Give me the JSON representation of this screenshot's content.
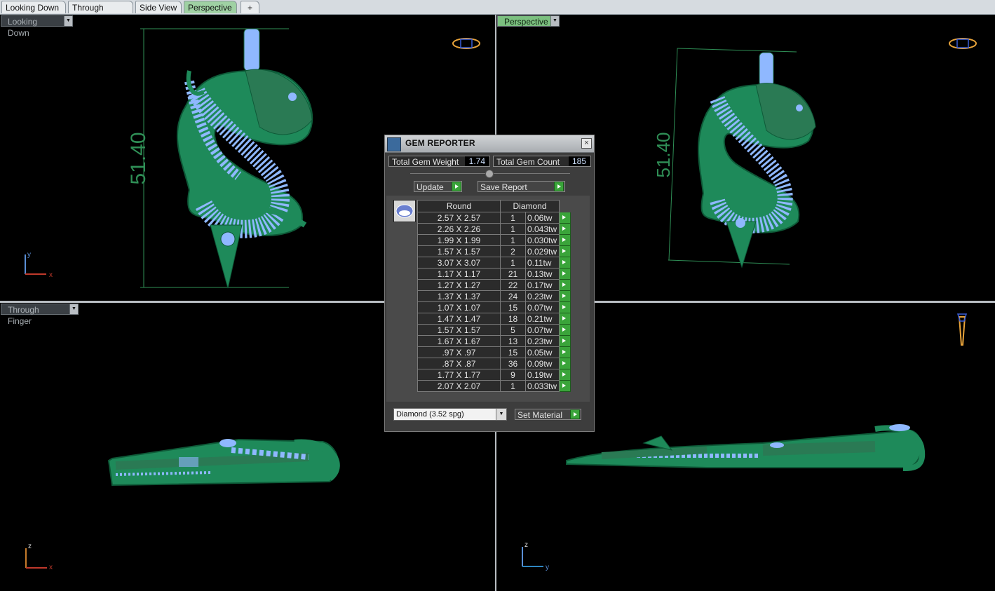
{
  "tabs": [
    {
      "label": "Looking Down",
      "active": false
    },
    {
      "label": "Through Finger",
      "active": false
    },
    {
      "label": "Side View",
      "active": false
    },
    {
      "label": "Perspective",
      "active": true
    }
  ],
  "add_tab_symbol": "+",
  "viewports": {
    "top_left": {
      "label": "Looking Down",
      "dimension": "51.40",
      "axes": [
        "y",
        "x"
      ]
    },
    "top_right": {
      "label": "Perspective",
      "dimension": "51.40"
    },
    "bottom_left": {
      "label": "Through Finger",
      "axes": [
        "z",
        "x"
      ]
    },
    "bottom_right": {
      "axes": [
        "z",
        "y"
      ]
    }
  },
  "gem_reporter": {
    "title": "GEM REPORTER",
    "close_symbol": "×",
    "total_weight_label": "Total Gem Weight",
    "total_weight_value": "1.74",
    "total_count_label": "Total Gem Count",
    "total_count_value": "185",
    "update_label": "Update",
    "save_report_label": "Save Report",
    "shape_header": "Round",
    "material_header": "Diamond",
    "rows": [
      {
        "size": "2.57 X 2.57",
        "count": "1",
        "weight": "0.06tw"
      },
      {
        "size": "2.26 X 2.26",
        "count": "1",
        "weight": "0.043tw"
      },
      {
        "size": "1.99 X 1.99",
        "count": "1",
        "weight": "0.030tw"
      },
      {
        "size": "1.57 X 1.57",
        "count": "2",
        "weight": "0.029tw"
      },
      {
        "size": "3.07 X 3.07",
        "count": "1",
        "weight": "0.11tw"
      },
      {
        "size": "1.17 X 1.17",
        "count": "21",
        "weight": "0.13tw"
      },
      {
        "size": "1.27 X 1.27",
        "count": "22",
        "weight": "0.17tw"
      },
      {
        "size": "1.37 X 1.37",
        "count": "24",
        "weight": "0.23tw"
      },
      {
        "size": "1.07 X 1.07",
        "count": "15",
        "weight": "0.07tw"
      },
      {
        "size": "1.47 X 1.47",
        "count": "18",
        "weight": "0.21tw"
      },
      {
        "size": "1.57 X 1.57",
        "count": "5",
        "weight": "0.07tw"
      },
      {
        "size": "1.67 X 1.67",
        "count": "13",
        "weight": "0.23tw"
      },
      {
        "size": ".97 X .97",
        "count": "15",
        "weight": "0.05tw"
      },
      {
        "size": ".87 X .87",
        "count": "36",
        "weight": "0.09tw"
      },
      {
        "size": "1.77 X 1.77",
        "count": "9",
        "weight": "0.19tw"
      },
      {
        "size": "2.07 X 2.07",
        "count": "1",
        "weight": "0.033tw"
      }
    ],
    "material_select": "Diamond    (3.52 spg)",
    "set_material_label": "Set Material"
  },
  "colors": {
    "model_green": "#1e8a5a",
    "gem_blue": "#8fb8ff",
    "dimension_line": "#2f8f56",
    "panel_bg": "#3d3d3d",
    "go_button": "#3aa43a"
  }
}
